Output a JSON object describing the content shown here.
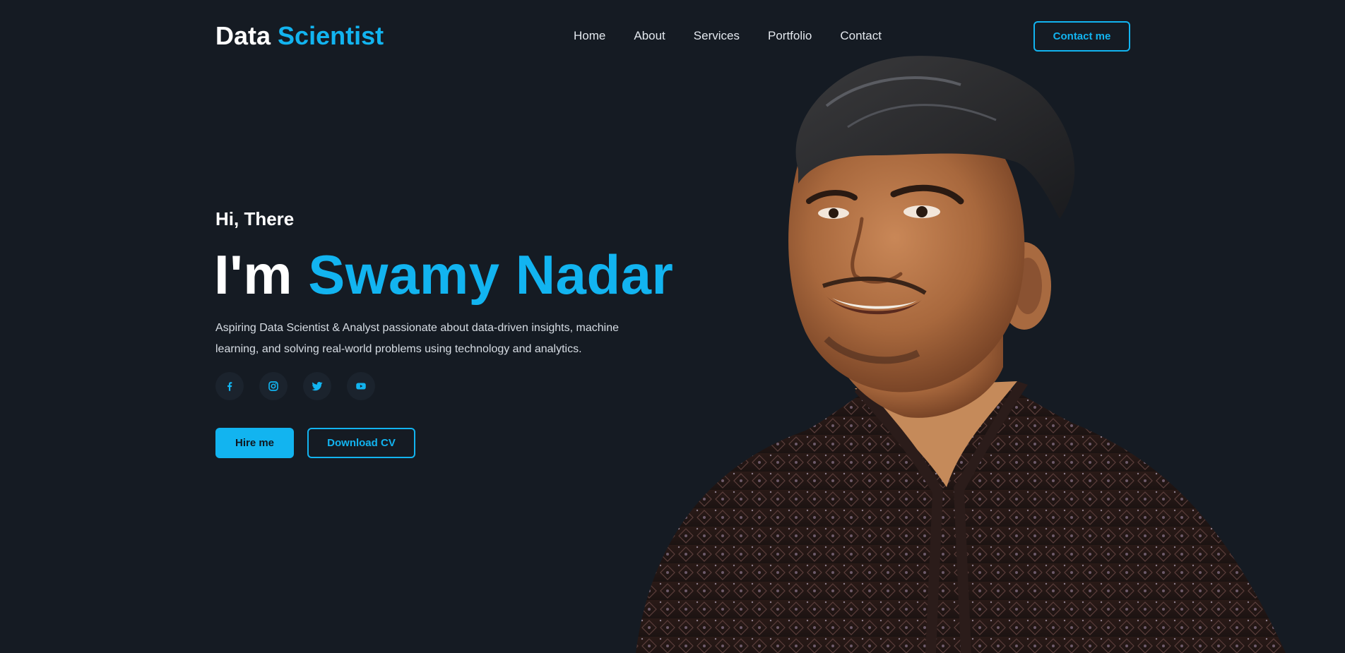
{
  "header": {
    "logo_part1": "Data",
    "logo_part2": "Scientist",
    "nav": [
      "Home",
      "About",
      "Services",
      "Portfolio",
      "Contact"
    ],
    "contact_button": "Contact me"
  },
  "hero": {
    "greeting": "Hi, There",
    "title_prefix": "I'm",
    "name": "Swamy Nadar",
    "description": "Aspiring Data Scientist & Analyst passionate about data-driven insights, machine learning, and solving real-world problems using technology and analytics.",
    "socials": [
      "facebook-icon",
      "instagram-icon",
      "twitter-icon",
      "youtube-icon"
    ],
    "hire_button": "Hire me",
    "download_button": "Download CV"
  },
  "colors": {
    "background": "#151b23",
    "accent": "#12b4f0",
    "text": "#ffffff"
  }
}
